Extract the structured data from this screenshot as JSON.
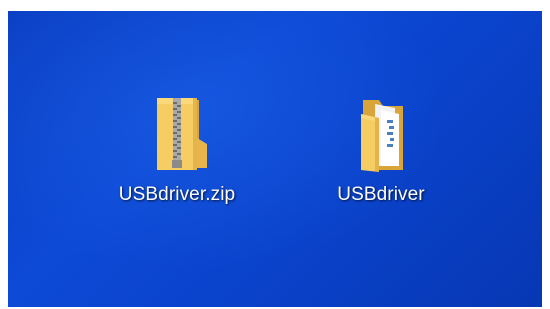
{
  "desktop": {
    "icons": [
      {
        "label": "USBdriver.zip",
        "icon": "zip-folder-icon"
      },
      {
        "label": "USBdriver",
        "icon": "folder-icon"
      }
    ]
  },
  "colors": {
    "desktop_background": "#0a43cc",
    "folder_yellow": "#f4c75a",
    "folder_dark": "#d9a53a",
    "label_text": "#ffffff"
  }
}
